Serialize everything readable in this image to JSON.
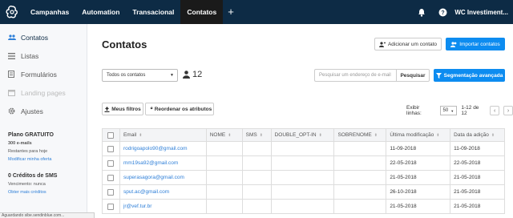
{
  "topnav": {
    "items": [
      "Campanhas",
      "Automation",
      "Transacional",
      "Contatos"
    ],
    "active": "Contatos",
    "plus": "+",
    "account": "WC Investiment..."
  },
  "sidebar": {
    "items": [
      {
        "label": "Contatos",
        "icon": "users-icon",
        "state": "active"
      },
      {
        "label": "Listas",
        "icon": "list-icon",
        "state": "normal"
      },
      {
        "label": "Formulários",
        "icon": "form-icon",
        "state": "normal"
      },
      {
        "label": "Landing pages",
        "icon": "landing-page-icon",
        "state": "disabled"
      },
      {
        "label": "Ajustes",
        "icon": "gear-icon",
        "state": "normal"
      }
    ],
    "plan": {
      "title": "Plano GRATUITO",
      "emails": "300 e-mails",
      "remaining": "Restantes para hoje",
      "link": "Modificar minha oferta"
    },
    "credits": {
      "title": "0 Créditos de SMS",
      "expiry": "Vencimento: nunca",
      "link": "Obter mais créditos"
    }
  },
  "main": {
    "title": "Contatos",
    "add_contact": "Adicionar um contato",
    "import_contacts": "Importar contatos",
    "filter_select": "Todos os contatos",
    "count": "12",
    "search_placeholder": "Pesquisar um endereço de e-mail",
    "search_button": "Pesquisar",
    "segmentation": "Segmentação avançada",
    "my_filters": "Meus filtros",
    "reorder": "Reordenar os atributos",
    "pager": {
      "label": "Exibir linhas:",
      "page_size": "50",
      "range": "1-12 de 12"
    }
  },
  "table": {
    "headers": [
      "Email",
      "NOME",
      "SMS",
      "DOUBLE_OPT-IN",
      "SOBRENOME",
      "Última modificação",
      "Data da adição"
    ],
    "rows": [
      {
        "email": "rodrigoapolo90@gmail.com",
        "modified": "11-09-2018",
        "added": "11-09-2018"
      },
      {
        "email": "mm19sa92@gmail.com",
        "modified": "22-05-2018",
        "added": "22-05-2018"
      },
      {
        "email": "superasagora@gmail.com",
        "modified": "21-05-2018",
        "added": "21-05-2018"
      },
      {
        "email": "sput.ac@gmail.com",
        "modified": "26-10-2018",
        "added": "21-05-2018"
      },
      {
        "email": "jr@vef.tur.br",
        "modified": "21-05-2018",
        "added": "21-05-2018"
      }
    ]
  },
  "statusbar": "Aguardando sibe.sendinblue.com..."
}
